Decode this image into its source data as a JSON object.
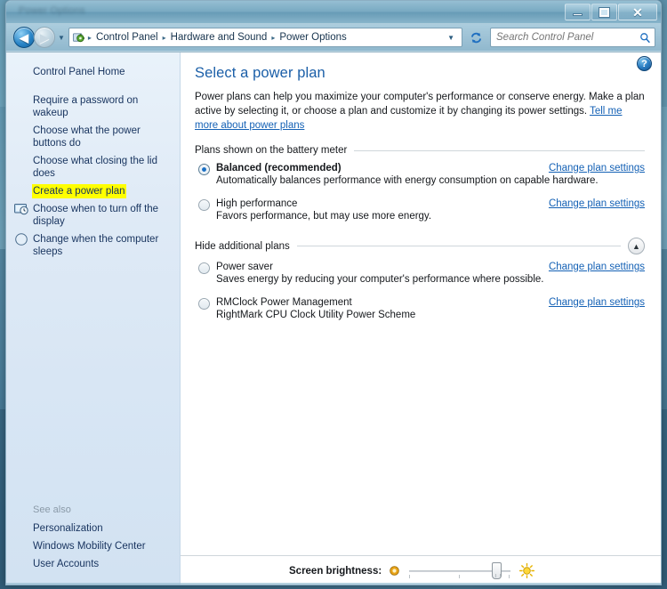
{
  "window": {
    "title": "Power Options",
    "controls": {
      "minimize": "minimize-button",
      "maximize": "maximize-button",
      "close": "close-button"
    }
  },
  "nav": {
    "back_label": "◀",
    "forward_label": "▶",
    "history_dropdown": "▼",
    "breadcrumbs": [
      "Control Panel",
      "Hardware and Sound",
      "Power Options"
    ],
    "address_dropdown": "▼",
    "refresh_label": "↻",
    "search": {
      "placeholder": "Search Control Panel",
      "value": ""
    }
  },
  "sidebar": {
    "items": [
      {
        "label": "Control Panel Home",
        "icon": null,
        "highlight": false
      },
      {
        "label": "Require a password on wakeup",
        "icon": null,
        "highlight": false
      },
      {
        "label": "Choose what the power buttons do",
        "icon": null,
        "highlight": false
      },
      {
        "label": "Choose what closing the lid does",
        "icon": null,
        "highlight": false
      },
      {
        "label": "Create a power plan",
        "icon": null,
        "highlight": true
      },
      {
        "label": "Choose when to turn off the display",
        "icon": "monitor-clock-icon",
        "highlight": false
      },
      {
        "label": "Change when the computer sleeps",
        "icon": "moon-sleep-icon",
        "highlight": false
      }
    ],
    "see_also": {
      "header": "See also",
      "items": [
        "Personalization",
        "Windows Mobility Center",
        "User Accounts"
      ]
    }
  },
  "main": {
    "help_label": "?",
    "title": "Select a power plan",
    "intro_text": "Power plans can help you maximize your computer's performance or conserve energy. Make a plan active by selecting it, or choose a plan and customize it by changing its power settings. ",
    "intro_link": "Tell me more about power plans",
    "section_primary": "Plans shown on the battery meter",
    "section_additional": "Hide additional plans",
    "collapse_icon": "▲",
    "change_link": "Change plan settings",
    "plans_primary": [
      {
        "name": "Balanced (recommended)",
        "desc": "Automatically balances performance with energy consumption on capable hardware.",
        "selected": true,
        "bold": true
      },
      {
        "name": "High performance",
        "desc": "Favors performance, but may use more energy.",
        "selected": false,
        "bold": false
      }
    ],
    "plans_additional": [
      {
        "name": "Power saver",
        "desc": "Saves energy by reducing your computer's performance where possible.",
        "selected": false,
        "bold": false
      },
      {
        "name": "RMClock Power Management",
        "desc": "RightMark CPU Clock Utility Power Scheme",
        "selected": false,
        "bold": false
      }
    ]
  },
  "brightness": {
    "label": "Screen brightness:",
    "low_icon": "dim-sun-icon",
    "high_icon": "bright-sun-icon",
    "value_percent": 90
  },
  "colors": {
    "accent_link": "#1461b5",
    "title_blue": "#1b5fa8",
    "highlight_yellow": "#ffff00",
    "sidebar_bg": "#dfeaf6",
    "radio_selected": "#1a6fc4"
  }
}
